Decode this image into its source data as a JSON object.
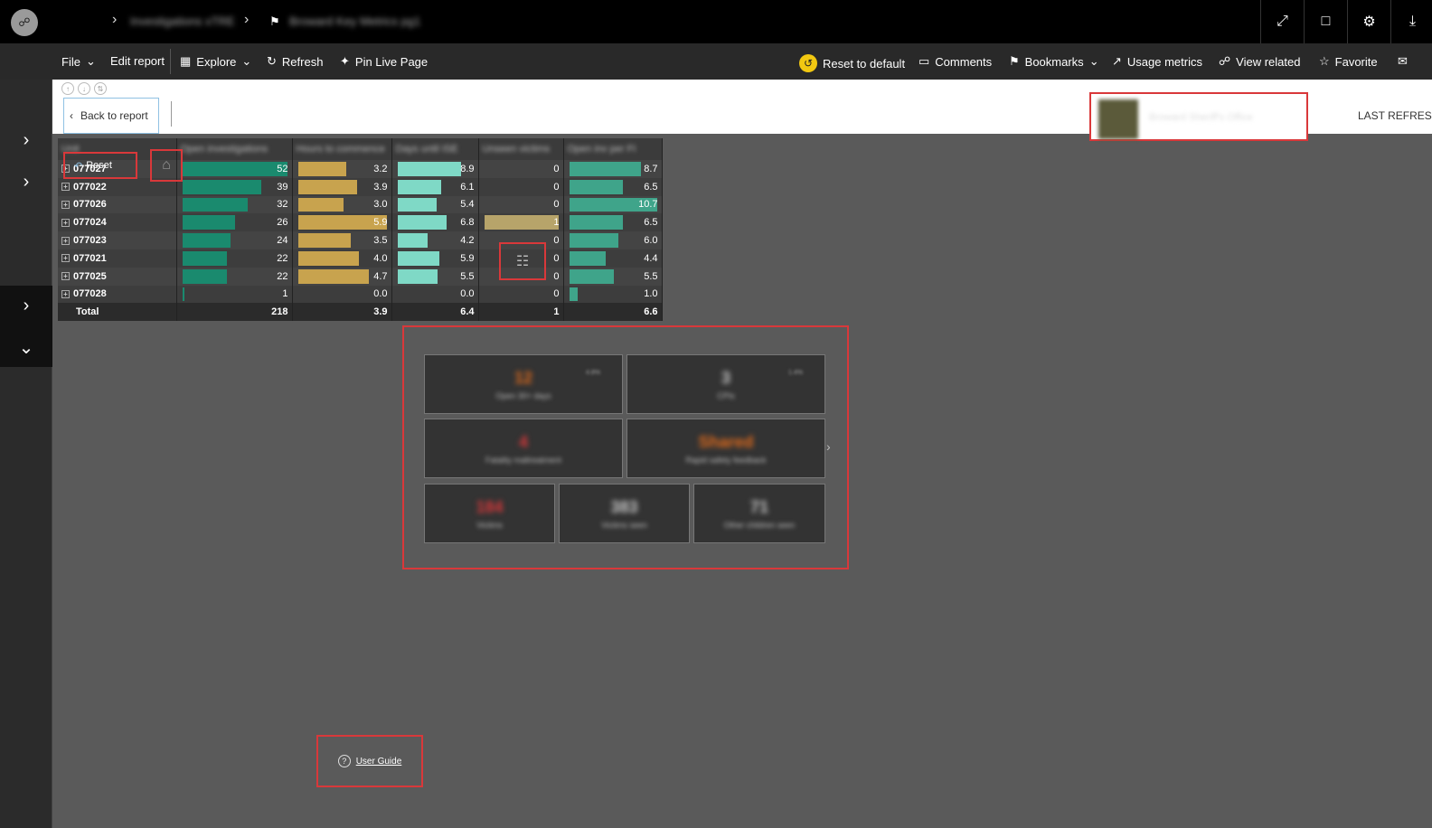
{
  "topbar": {
    "breadcrumbs": [
      "Investigations xTRE",
      "Broward Key Metrics pg1"
    ],
    "right_buttons": [
      "expand-icon",
      "comment-icon",
      "gear-icon",
      "download-icon"
    ]
  },
  "toolbar": {
    "file": "File",
    "edit_report": "Edit report",
    "explore": "Explore",
    "refresh": "Refresh",
    "pin_live_page": "Pin Live Page",
    "reset_to_default": "Reset to default",
    "comments": "Comments",
    "bookmarks": "Bookmarks",
    "usage_metrics": "Usage metrics",
    "view_related": "View related",
    "favorite": "Favorite"
  },
  "header": {
    "back_to_report": "Back to report",
    "last_refresh": "LAST REFRES",
    "logo_text": "Broward Sheriff's Office"
  },
  "overlays": {
    "reset": "Reset",
    "user_guide": "User Guide"
  },
  "matrix": {
    "columns": [
      "Unit",
      "Open investigations",
      "Hours to commence",
      "Days until ISE",
      "Unseen victims",
      "Open inv per FI"
    ],
    "rows": [
      {
        "id": "077027",
        "c1": "52",
        "c2": "3.2",
        "c3": "8.9",
        "c4": "0",
        "c5": "8.7",
        "f1": 1.0,
        "f2": 0.54,
        "f3": 0.83,
        "f4": 0,
        "f5": 0.81
      },
      {
        "id": "077022",
        "c1": "39",
        "c2": "3.9",
        "c3": "6.1",
        "c4": "0",
        "c5": "6.5",
        "f1": 0.75,
        "f2": 0.66,
        "f3": 0.57,
        "f4": 0,
        "f5": 0.61
      },
      {
        "id": "077026",
        "c1": "32",
        "c2": "3.0",
        "c3": "5.4",
        "c4": "0",
        "c5": "10.7",
        "f1": 0.62,
        "f2": 0.51,
        "f3": 0.51,
        "f4": 0,
        "f5": 1.0
      },
      {
        "id": "077024",
        "c1": "26",
        "c2": "5.9",
        "c3": "6.8",
        "c4": "1",
        "c5": "6.5",
        "f1": 0.5,
        "f2": 1.0,
        "f3": 0.64,
        "f4": 1.0,
        "f5": 0.61
      },
      {
        "id": "077023",
        "c1": "24",
        "c2": "3.5",
        "c3": "4.2",
        "c4": "0",
        "c5": "6.0",
        "f1": 0.46,
        "f2": 0.59,
        "f3": 0.39,
        "f4": 0,
        "f5": 0.56
      },
      {
        "id": "077021",
        "c1": "22",
        "c2": "4.0",
        "c3": "5.9",
        "c4": "0",
        "c5": "4.4",
        "f1": 0.42,
        "f2": 0.68,
        "f3": 0.55,
        "f4": 0,
        "f5": 0.41
      },
      {
        "id": "077025",
        "c1": "22",
        "c2": "4.7",
        "c3": "5.5",
        "c4": "0",
        "c5": "5.5",
        "f1": 0.42,
        "f2": 0.8,
        "f3": 0.52,
        "f4": 0,
        "f5": 0.51
      },
      {
        "id": "077028",
        "c1": "1",
        "c2": "0.0",
        "c3": "0.0",
        "c4": "0",
        "c5": "1.0",
        "f1": 0.02,
        "f2": 0,
        "f3": 0,
        "f4": 0,
        "f5": 0.09
      }
    ],
    "total": {
      "label": "Total",
      "c1": "218",
      "c2": "3.9",
      "c3": "6.4",
      "c4": "1",
      "c5": "6.6"
    },
    "colors": {
      "c1": "#1a8a6e",
      "c2": "#c8a34e",
      "c3": "#7fd9c6",
      "c4": "#b7a46a",
      "c5": "#3fa48a"
    }
  },
  "kpis": [
    {
      "value": "12",
      "label": "Open 30+ days",
      "badge": "4.8%",
      "color": "#e06a1b"
    },
    {
      "value": "3",
      "label": "CPIs",
      "badge": "1.4%",
      "color": "#cccccc"
    },
    {
      "value": "4",
      "label": "Fatality maltreatment",
      "color": "#d9383a"
    },
    {
      "value": "Shared",
      "label": "Rapid safety feedback",
      "color": "#e06a1b"
    },
    {
      "value": "184",
      "label": "Victims",
      "color": "#d9383a"
    },
    {
      "value": "383",
      "label": "Victims seen",
      "color": "#cccccc"
    },
    {
      "value": "71",
      "label": "Other children seen",
      "color": "#cccccc"
    }
  ]
}
